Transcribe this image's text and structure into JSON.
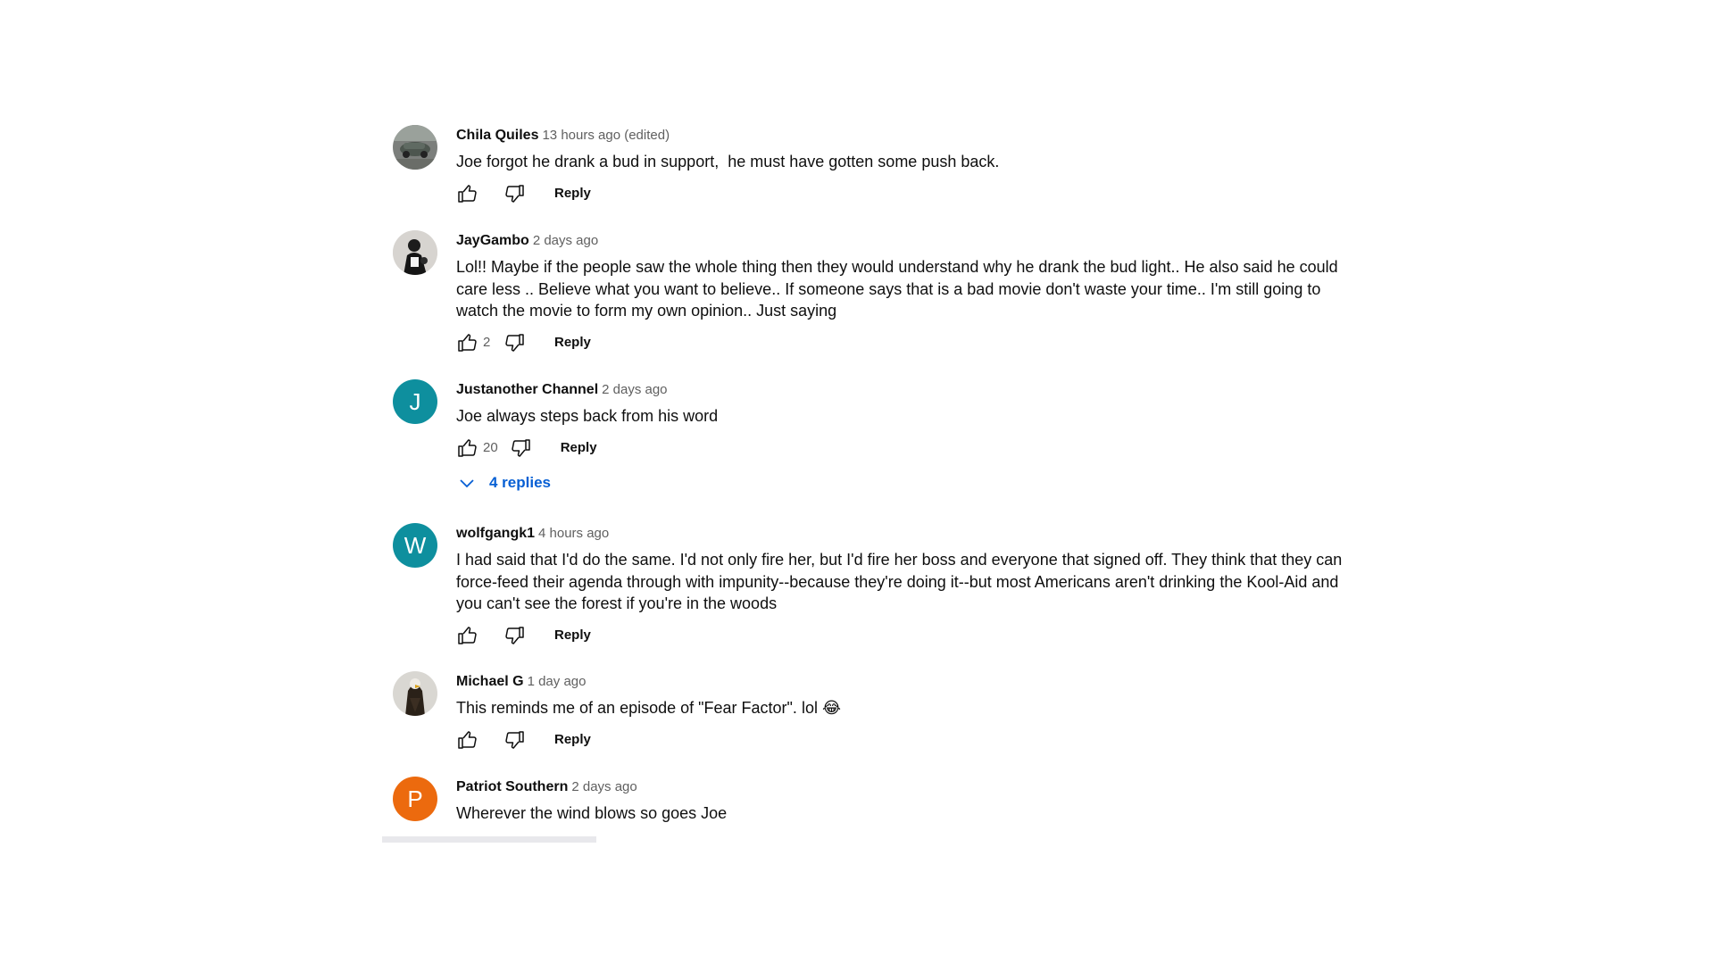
{
  "comments": [
    {
      "author": "Chila Quiles",
      "time": "13 hours ago (edited)",
      "text": "Joe forgot he drank a bud in support,  he must have gotten some push back.",
      "likes": "",
      "reply_label": "Reply",
      "avatar": {
        "type": "photo",
        "icon": "car-photo-avatar"
      }
    },
    {
      "author": "JayGambo",
      "time": "2 days ago",
      "text": "Lol!! Maybe if the people saw the whole thing then they would understand why he drank the bud light.. He also said he could care less .. Believe what you want to believe.. If someone says that is a bad movie don't waste your time.. I'm still going to watch the movie to form my own opinion.. Just saying",
      "likes": "2",
      "reply_label": "Reply",
      "avatar": {
        "type": "photo",
        "icon": "person-photo-avatar"
      }
    },
    {
      "author": "Justanother Channel",
      "time": "2 days ago",
      "text": "Joe always steps back from his word",
      "likes": "20",
      "reply_label": "Reply",
      "avatar": {
        "type": "letter",
        "letter": "J",
        "color": "#0e8f9e"
      },
      "replies_label": "4 replies"
    },
    {
      "author": "wolfgangk1",
      "time": "4 hours ago",
      "text": "I had said that I'd do the same. I'd not only fire her, but I'd fire her boss and everyone that signed off. They think that they can force-feed their agenda through with impunity--because they're doing it--but most Americans aren't drinking the Kool-Aid and you can't see the forest if you're in the woods",
      "likes": "",
      "reply_label": "Reply",
      "avatar": {
        "type": "letter",
        "letter": "W",
        "color": "#0e8f9e"
      }
    },
    {
      "author": "Michael G",
      "time": "1 day ago",
      "text": "This reminds me of an episode of \"Fear Factor\". lol 😂",
      "likes": "",
      "reply_label": "Reply",
      "avatar": {
        "type": "photo",
        "icon": "eagle-photo-avatar"
      }
    },
    {
      "author": "Patriot Southern",
      "time": "2 days ago",
      "text": "Wherever the wind blows so goes Joe",
      "likes": "",
      "reply_label": "Reply",
      "avatar": {
        "type": "letter",
        "letter": "P",
        "color": "#ec6a0e"
      }
    }
  ],
  "icons": {
    "like": "thumbs-up-icon",
    "dislike": "thumbs-down-icon",
    "expand": "chevron-down-icon"
  },
  "colors": {
    "link_blue": "#065fd4",
    "secondary_text": "#606060",
    "avatar_teal": "#0e8f9e",
    "avatar_orange": "#ec6a0e"
  }
}
